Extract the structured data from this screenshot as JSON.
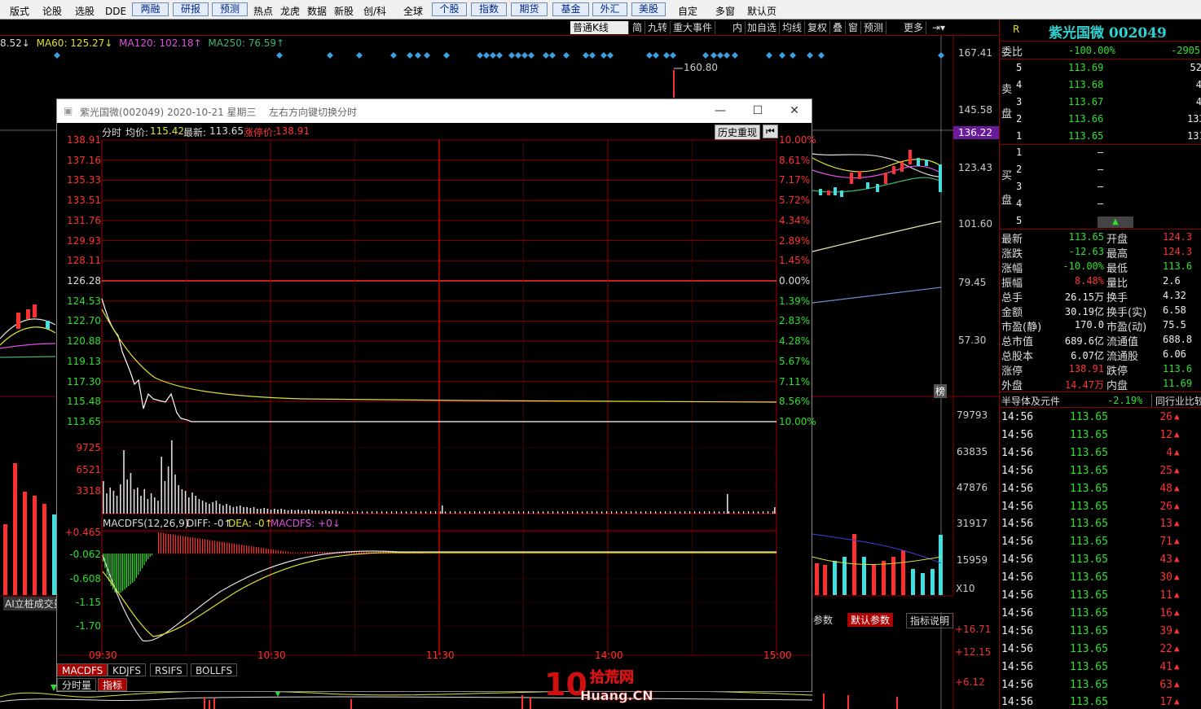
{
  "toolbar": {
    "items": [
      "版式",
      "论股",
      "选股",
      "DDE",
      "两融",
      "研报",
      "预测",
      "热点",
      "龙虎",
      "数据",
      "新股",
      "创/科",
      "全球",
      "个股",
      "指数",
      "期货",
      "基金",
      "外汇",
      "美股",
      "自定",
      "多窗",
      "默认页"
    ]
  },
  "kline_bar": {
    "period": "普通K线",
    "buttons": [
      "简",
      "九转",
      "重大事件",
      "内",
      "加自选",
      "均线",
      "复权",
      "叠",
      "窗",
      "预测",
      "更多"
    ]
  },
  "ma_line": {
    "ma20": "8.52↓",
    "ma60": "MA60: 125.27↓",
    "ma120": "MA120: 102.18↑",
    "ma250": "MA250: 76.59↑"
  },
  "price_axis": [
    "167.41",
    "145.58",
    "136.22",
    "123.43",
    "101.60",
    "79.45",
    "57.30"
  ],
  "volume_axis": [
    "79793",
    "63835",
    "47876",
    "31917",
    "15959",
    "X10"
  ],
  "macd_axis": [
    "+16.71",
    "+12.15",
    "+6.12"
  ],
  "kline": {
    "high_label": "160.80",
    "side_tag": "榜",
    "left_label": "AI立桩成交量",
    "param_tabs": [
      "参数",
      "默认参数",
      "指标说明"
    ]
  },
  "dialog": {
    "title": "紫光国微(002049) 2020-10-21 星期三",
    "hint": "左右方向键切换分时",
    "header": {
      "label": "分时",
      "avg_label": "均价:",
      "avg": "115.42",
      "last_label": "最新:",
      "last": "113.65",
      "limit_label": "涨停价:",
      "limit": "138.91"
    },
    "history_btn": "历史重现",
    "price_ticks": [
      "138.91",
      "137.16",
      "135.33",
      "133.51",
      "131.76",
      "129.93",
      "128.11",
      "126.28",
      "124.53",
      "122.70",
      "120.88",
      "119.13",
      "117.30",
      "115.48",
      "113.65"
    ],
    "pct_ticks": [
      "10.00%",
      "8.61%",
      "7.17%",
      "5.72%",
      "4.34%",
      "2.89%",
      "1.45%",
      "0.00%",
      "1.39%",
      "2.83%",
      "4.28%",
      "5.67%",
      "7.11%",
      "8.56%",
      "10.00%"
    ],
    "vol_ticks": [
      "9725",
      "6521",
      "3318"
    ],
    "macd_header": {
      "name": "MACDFS(12,26,9)",
      "diff": "DIFF: -0↑",
      "dea": "DEA: -0↑",
      "macd": "MACDFS: +0↓"
    },
    "macd_ticks": [
      "+0.465",
      "-0.062",
      "-0.608",
      "-1.15",
      "-1.70"
    ],
    "time_ticks": [
      "09:30",
      "10:30",
      "11:30",
      "14:00",
      "15:00"
    ],
    "tabs": [
      "MACDFS",
      "KDJFS",
      "RSIFS",
      "BOLLFS"
    ],
    "tabs2": [
      "分时量",
      "指标"
    ]
  },
  "quote": {
    "r_badge": "R",
    "name": "紫光国微 002049",
    "ratio_label": "委比",
    "ratio": "-100.00%",
    "ratio_diff": "-2905",
    "sell_label": "卖盘",
    "buy_label": "买盘",
    "asks": [
      {
        "n": "5",
        "p": "113.69",
        "v": "52"
      },
      {
        "n": "4",
        "p": "113.68",
        "v": "4"
      },
      {
        "n": "3",
        "p": "113.67",
        "v": "4"
      },
      {
        "n": "2",
        "p": "113.66",
        "v": "133"
      },
      {
        "n": "1",
        "p": "113.65",
        "v": "1318"
      }
    ],
    "bids": [
      {
        "n": "1",
        "p": "–"
      },
      {
        "n": "2",
        "p": "–"
      },
      {
        "n": "3",
        "p": "–"
      },
      {
        "n": "4",
        "p": "–"
      },
      {
        "n": "5",
        "p": ""
      }
    ],
    "stats": [
      {
        "l1": "最新",
        "v1": "113.65",
        "l2": "开盘",
        "v2": "124.3"
      },
      {
        "l1": "涨跌",
        "v1": "-12.63",
        "l2": "最高",
        "v2": "124.3"
      },
      {
        "l1": "涨幅",
        "v1": "-10.00%",
        "l2": "最低",
        "v2": "113.6"
      },
      {
        "l1": "振幅",
        "v1": "8.48%",
        "l2": "量比",
        "v2": "2.6"
      },
      {
        "l1": "总手",
        "v1": "26.15万",
        "l2": "换手",
        "v2": "4.32"
      },
      {
        "l1": "金额",
        "v1": "30.19亿",
        "l2": "换手(实)",
        "v2": "6.58"
      },
      {
        "l1": "市盈(静)",
        "v1": "170.0",
        "l2": "市盈(动)",
        "v2": "75.5"
      },
      {
        "l1": "总市值",
        "v1": "689.6亿",
        "l2": "流通值",
        "v2": "688.8"
      },
      {
        "l1": "总股本",
        "v1": "6.07亿",
        "l2": "流通股",
        "v2": "6.06"
      },
      {
        "l1": "涨停",
        "v1": "138.91",
        "l2": "跌停",
        "v2": "113.6"
      },
      {
        "l1": "外盘",
        "v1": "14.47万",
        "l2": "内盘",
        "v2": "11.69"
      }
    ],
    "sector": "半导体及元件",
    "sector_pct": "-2.19%",
    "sector_btn": "同行业比较",
    "ticks": [
      {
        "t": "14:56",
        "p": "113.65",
        "v": "26"
      },
      {
        "t": "14:56",
        "p": "113.65",
        "v": "12"
      },
      {
        "t": "14:56",
        "p": "113.65",
        "v": "4"
      },
      {
        "t": "14:56",
        "p": "113.65",
        "v": "25"
      },
      {
        "t": "14:56",
        "p": "113.65",
        "v": "48"
      },
      {
        "t": "14:56",
        "p": "113.65",
        "v": "26"
      },
      {
        "t": "14:56",
        "p": "113.65",
        "v": "13"
      },
      {
        "t": "14:56",
        "p": "113.65",
        "v": "71"
      },
      {
        "t": "14:56",
        "p": "113.65",
        "v": "43"
      },
      {
        "t": "14:56",
        "p": "113.65",
        "v": "30"
      },
      {
        "t": "14:56",
        "p": "113.65",
        "v": "11"
      },
      {
        "t": "14:56",
        "p": "113.65",
        "v": "16"
      },
      {
        "t": "14:56",
        "p": "113.65",
        "v": "39"
      },
      {
        "t": "14:56",
        "p": "113.65",
        "v": "22"
      },
      {
        "t": "14:56",
        "p": "113.65",
        "v": "41"
      },
      {
        "t": "14:56",
        "p": "113.65",
        "v": "63"
      },
      {
        "t": "14:56",
        "p": "113.65",
        "v": "17"
      }
    ]
  },
  "watermark": {
    "num": "10",
    "cn": "拾荒网",
    "en": "Huang.CN"
  }
}
